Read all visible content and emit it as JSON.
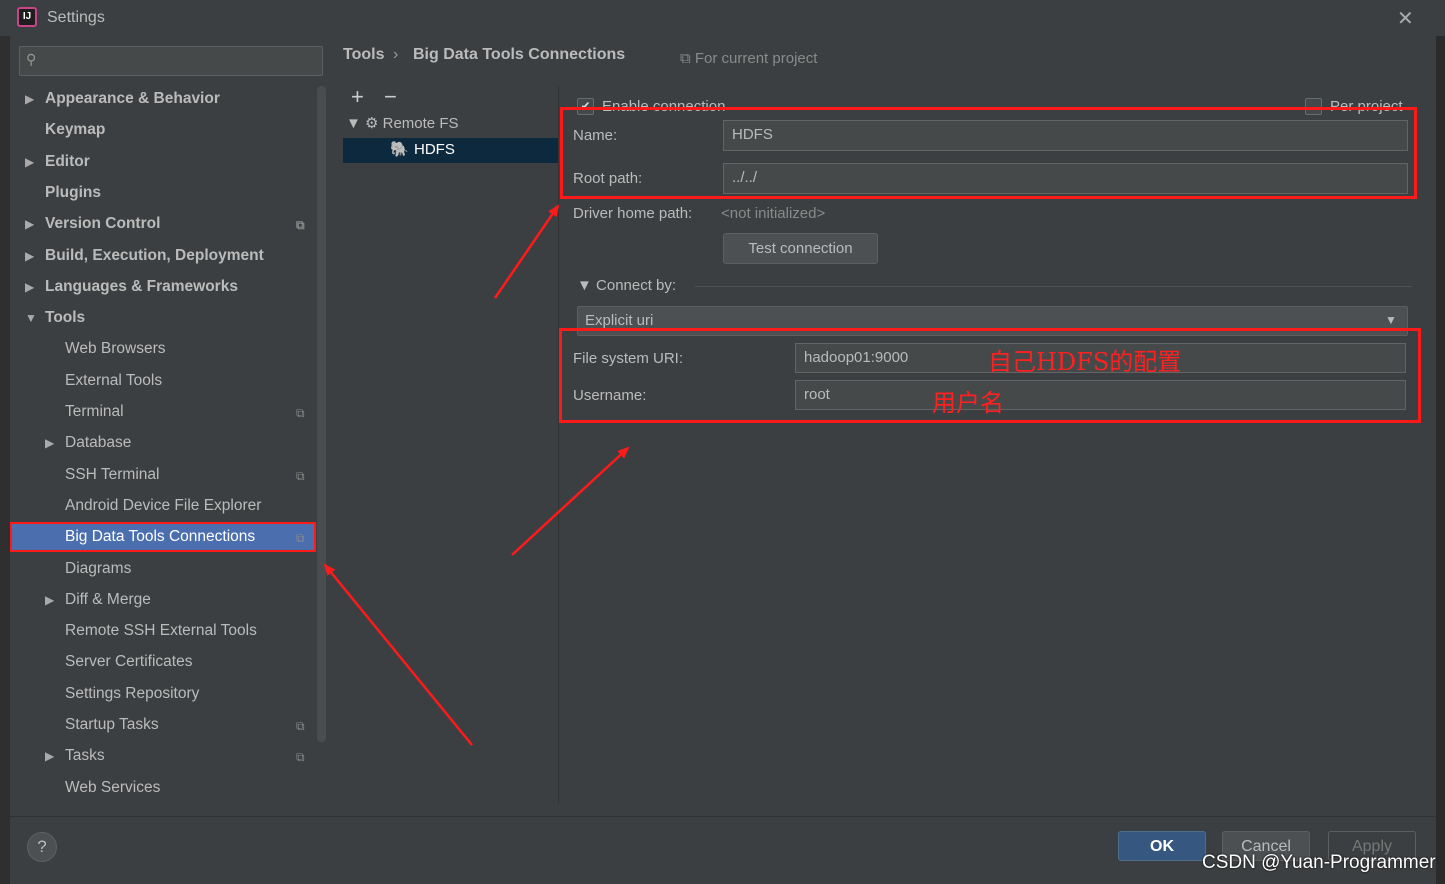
{
  "window": {
    "title": "Settings",
    "app_icon": "IJ",
    "close_glyph": "✕"
  },
  "search": {
    "placeholder": ""
  },
  "nav": {
    "items": [
      {
        "label": "Appearance & Behavior",
        "arrow": "▶",
        "bold": true,
        "indent": 0
      },
      {
        "label": "Keymap",
        "bold": true,
        "indent": 0
      },
      {
        "label": "Editor",
        "arrow": "▶",
        "bold": true,
        "indent": 0
      },
      {
        "label": "Plugins",
        "bold": true,
        "indent": 0
      },
      {
        "label": "Version Control",
        "arrow": "▶",
        "bold": true,
        "indent": 0,
        "project": true
      },
      {
        "label": "Build, Execution, Deployment",
        "arrow": "▶",
        "bold": true,
        "indent": 0
      },
      {
        "label": "Languages & Frameworks",
        "arrow": "▶",
        "bold": true,
        "indent": 0
      },
      {
        "label": "Tools",
        "arrow": "▼",
        "bold": true,
        "indent": 0
      },
      {
        "label": "Web Browsers",
        "indent": 1
      },
      {
        "label": "External Tools",
        "indent": 1
      },
      {
        "label": "Terminal",
        "indent": 1,
        "project": true
      },
      {
        "label": "Database",
        "arrow": "▶",
        "indent": 1
      },
      {
        "label": "SSH Terminal",
        "indent": 1,
        "project": true
      },
      {
        "label": "Android Device File Explorer",
        "indent": 1
      },
      {
        "label": "Big Data Tools Connections",
        "indent": 1,
        "project": true,
        "selected": true
      },
      {
        "label": "Diagrams",
        "indent": 1
      },
      {
        "label": "Diff & Merge",
        "arrow": "▶",
        "indent": 1
      },
      {
        "label": "Remote SSH External Tools",
        "indent": 1
      },
      {
        "label": "Server Certificates",
        "indent": 1
      },
      {
        "label": "Settings Repository",
        "indent": 1
      },
      {
        "label": "Startup Tasks",
        "indent": 1,
        "project": true
      },
      {
        "label": "Tasks",
        "arrow": "▶",
        "indent": 1,
        "project": true
      },
      {
        "label": "Web Services",
        "indent": 1
      }
    ]
  },
  "breadcrumb": {
    "parent": "Tools",
    "separator": "›",
    "current": "Big Data Tools Connections",
    "scope": "⧉ For current project"
  },
  "tree": {
    "add": "+",
    "remove": "−",
    "root": "▼ ⚙ Remote FS",
    "child": "HDFS"
  },
  "form": {
    "enable_label": "Enable connection",
    "enable_checked": "✔",
    "per_project_label": "Per project",
    "name_label": "Name:",
    "name_value": "HDFS",
    "root_path_label": "Root path:",
    "root_path_value": "../../",
    "driver_label": "Driver home path:",
    "driver_value": "<not initialized>",
    "test_button": "Test connection",
    "connect_by_label": "▼  Connect by:",
    "connect_by_value": "Explicit uri",
    "uri_label": "File system URI:",
    "uri_value": "hadoop01:9000",
    "username_label": "Username:",
    "username_value": "root"
  },
  "annotations": {
    "uri_note": "自己HDFS的配置",
    "user_note": "用户名"
  },
  "footer": {
    "help": "?",
    "ok": "OK",
    "cancel": "Cancel",
    "apply": "Apply"
  },
  "watermark": "CSDN @Yuan-Programmer",
  "colors": {
    "accent": "#4b6eaf",
    "annotation_red": "#ff1a1a",
    "background": "#3c3f41"
  }
}
